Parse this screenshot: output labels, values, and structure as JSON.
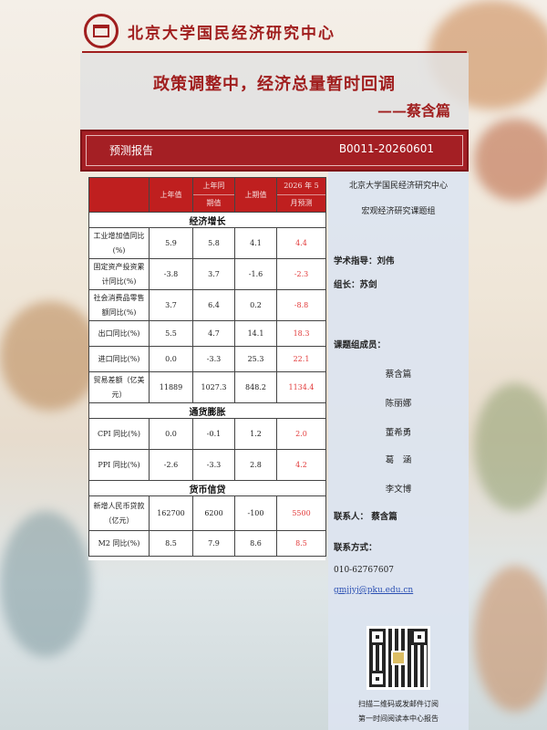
{
  "header": {
    "logo_text": "北京大学国民经济研究中心"
  },
  "title": "政策调整中，经济总量暂时回调",
  "author": "——蔡含篇",
  "banner": {
    "label": "预测报告",
    "code": "B0011-20260601"
  },
  "table": {
    "headers": [
      "",
      "上年值",
      [
        "上年同",
        "期值"
      ],
      "上期值",
      [
        "2026 年 5",
        "月预测"
      ]
    ],
    "sections": [
      {
        "title": "经济增长",
        "rows": [
          {
            "label": "工业增加值同比(%)",
            "vals": [
              "5.9",
              "5.8",
              "4.1",
              "4.4"
            ]
          },
          {
            "label": "固定资产投资累计同比(%)",
            "vals": [
              "-3.8",
              "3.7",
              "-1.6",
              "-2.3"
            ]
          },
          {
            "label": "社会消费品零售额同比(%)",
            "vals": [
              "3.7",
              "6.4",
              "0.2",
              "-8.8"
            ]
          },
          {
            "label": "出口同比(%)",
            "vals": [
              "5.5",
              "4.7",
              "14.1",
              "18.3"
            ]
          },
          {
            "label": "进口同比(%)",
            "vals": [
              "0.0",
              "-3.3",
              "25.3",
              "22.1"
            ]
          },
          {
            "label": "贸易差额（亿美元）",
            "vals": [
              "11889",
              "1027.3",
              "848.2",
              "1134.4"
            ]
          }
        ]
      },
      {
        "title": "通货膨胀",
        "rows": [
          {
            "label": "CPI 同比(%)",
            "vals": [
              "0.0",
              "-0.1",
              "1.2",
              "2.0"
            ]
          },
          {
            "label": "PPI 同比(%)",
            "vals": [
              "-2.6",
              "-3.3",
              "2.8",
              "4.2"
            ]
          }
        ]
      },
      {
        "title": "货币信贷",
        "rows": [
          {
            "label": "新增人民币贷款（亿元）",
            "vals": [
              "162700",
              "6200",
              "-100",
              "5500"
            ]
          },
          {
            "label": "M2 同比(%)",
            "vals": [
              "8.5",
              "7.9",
              "8.6",
              "8.5"
            ]
          }
        ]
      }
    ]
  },
  "side": {
    "org": "北京大学国民经济研究中心",
    "group": "宏观经济研究课题组",
    "advisor": "学术指导：刘伟",
    "leader": "组长：苏剑",
    "members_title": "课题组成员：",
    "members": [
      "蔡含篇",
      "陈丽娜",
      "董希勇",
      "葛　涵",
      "李文博"
    ],
    "contact": "联系人：  蔡含篇",
    "contact_method": "联系方式：",
    "phone": "010-62767607",
    "email": "gmjjyj@pku.edu.cn",
    "scan_line1": "扫描二维码或发邮件订阅",
    "scan_line2": "第一时间阅读本中心报告"
  }
}
